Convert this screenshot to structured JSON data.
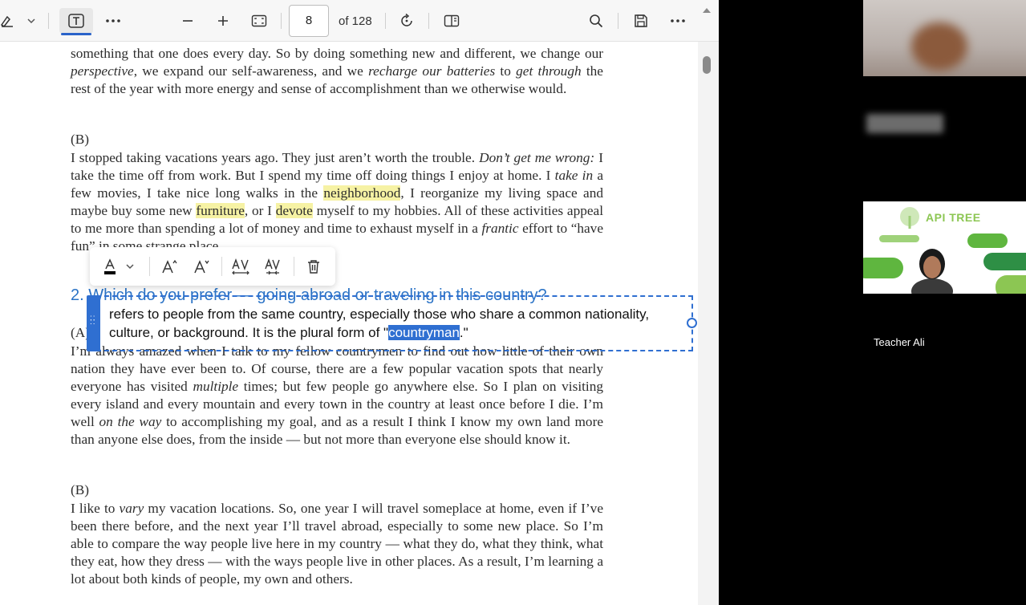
{
  "viewer": {
    "page_number": "8",
    "page_total": "of 128"
  },
  "page": {
    "para1": {
      "t1": "something that one does every day. So by doing something new and different, we change our ",
      "i1": "perspective",
      "t2": ", we expand our self-awareness, and we ",
      "i2": "recharge our batteries",
      "t3": " to ",
      "i3": "get through",
      "t4": " the rest of the year with more energy and sense of accomplishment than we otherwise would."
    },
    "label_b1": "(B)",
    "para2": {
      "t1": " I stopped taking vacations years ago. They just aren’t worth the trouble. ",
      "i1": "Don’t get me wrong:",
      "t2": " I take the time off from work. But I spend my time off doing things I enjoy at home. I ",
      "i2": "take in",
      "t3": " a few movies, I take nice long walks in the ",
      "h1": "neighborhood",
      "t4": ", I reorganize my living space and maybe buy some new ",
      "h2": "furniture",
      "t5": ", or I ",
      "h3": "devote",
      "t6": " myself to my hobbies. All of these activities appeal to me more than spending a lot of money and time to exhaust myself in a ",
      "i3": "frantic",
      "t7": " effort to “have fun” in some strange place."
    },
    "question": "2. Which do you prefer — going abroad or traveling in this country?",
    "label_a": "(A)",
    "para3_line1": "I’m always amazed when I talk to my fellow countrymen to find out how little of their",
    "para3": {
      "t1": "own nation they have ever been to. Of course, there are a few popular vacation spots that nearly everyone has visited ",
      "i1": "multiple",
      "t2": " times; but few people go anywhere else. So I plan on visiting every island and every mountain and every town in the country at least once before I die. I’m well ",
      "i2": "on the way",
      "t3": " to accomplishing my goal, and as a result I think I know my own land more than anyone else does, from the inside — but not more than everyone else should know it."
    },
    "label_b2": "(B)",
    "para4": {
      "t1": "I like to ",
      "i1": "vary",
      "t2": " my vacation locations. So, one year I will travel someplace at home, even if I’ve been there before, and the next year I’ll travel abroad, especially to some new place. So I’m able to compare the way people live here in my country — what they do, what they think, what they eat, how they dress — with the ways people live in other places. As a result, I’m learning a lot about both kinds of people, my own and others."
    }
  },
  "annotation": {
    "text_before": "refers to people from the same country, especially those who share a common nationality, culture, or background. It is the plural form of \"",
    "selected": "countryman",
    "text_after": ".\""
  },
  "meeting": {
    "brand": "API TREE",
    "participant_name": "Teacher Ali"
  },
  "colors": {
    "highlight": "#f6f2a4",
    "accent_blue": "#2f6fd1",
    "brand_green": "#5fb63f"
  }
}
